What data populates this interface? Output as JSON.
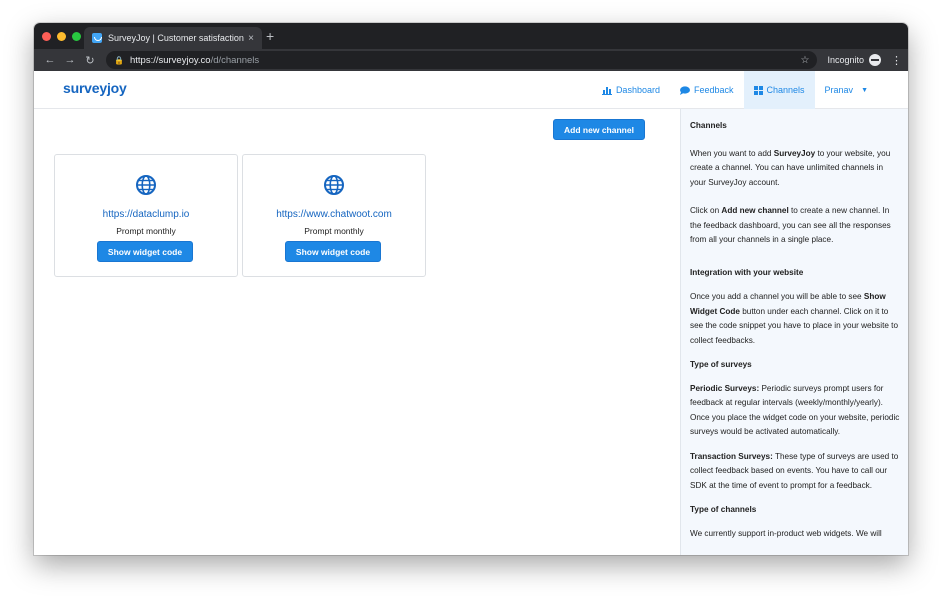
{
  "browser": {
    "tab_title": "SurveyJoy | Customer satisfaction",
    "tab_close": "×",
    "new_tab": "+",
    "url_host": "https://surveyjoy.co",
    "url_path": "/d/channels",
    "incognito_label": "Incognito"
  },
  "header": {
    "logo": "surveyjoy",
    "nav": [
      {
        "label": "Dashboard",
        "icon": "bar-chart-icon"
      },
      {
        "label": "Feedback",
        "icon": "chat-bubble-icon"
      },
      {
        "label": "Channels",
        "icon": "grid-icon",
        "active": true
      }
    ],
    "user": "Pranav"
  },
  "main": {
    "add_button": "Add new channel",
    "channels": [
      {
        "url": "https://dataclump.io",
        "frequency": "Prompt monthly",
        "button": "Show widget code"
      },
      {
        "url": "https://www.chatwoot.com",
        "frequency": "Prompt monthly",
        "button": "Show widget code"
      }
    ]
  },
  "sidebar": {
    "title": "Channels",
    "p1_a": "When you want to add ",
    "p1_b": "SurveyJoy",
    "p1_c": " to your website, you create a channel. You can have unlimited channels in your SurveyJoy account.",
    "p2_a": "Click on ",
    "p2_b": "Add new channel",
    "p2_c": " to create a new channel. In the feedback dashboard, you can see all the responses from all your channels in a single place.",
    "h_integration": "Integration with your website",
    "p3_a": "Once you add a channel you will be able to see ",
    "p3_b": "Show Widget Code",
    "p3_c": " button under each channel. Click on it to see the code snippet you have to place in your website to collect feedbacks.",
    "h_types": "Type of surveys",
    "p4_b": "Periodic Surveys:",
    "p4_c": " Periodic surveys prompt users for feedback at regular intervals (weekly/monthly/yearly). Once you place the widget code on your website, periodic surveys would be activated automatically.",
    "p5_b": "Transaction Surveys:",
    "p5_c": " These type of surveys are used to collect feedback based on events. You have to call our SDK at the time of event to prompt for a feedback.",
    "h_channels": "Type of channels",
    "p6": "We currently support in-product web widgets. We will"
  },
  "colors": {
    "primary": "#1e88e5",
    "logo": "#1565c0",
    "sidebar_bg": "#f4f8fd"
  }
}
